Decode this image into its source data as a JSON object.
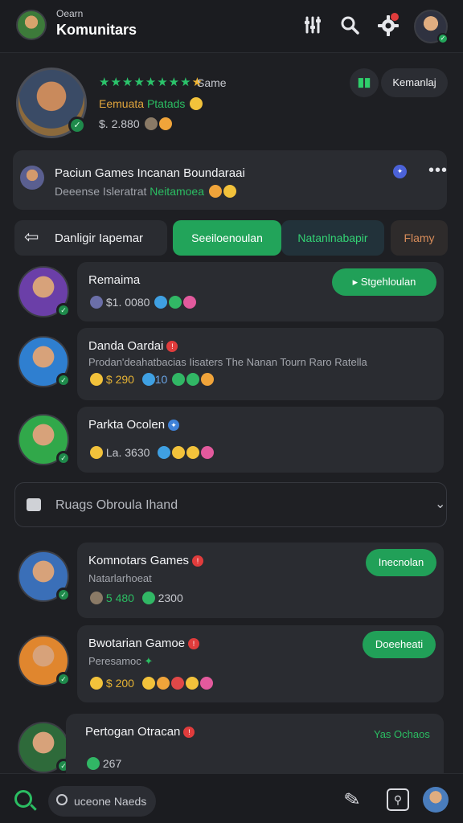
{
  "header": {
    "subtitle": "Oearn",
    "title": "Komunitars"
  },
  "profile": {
    "stars_label": "Same",
    "sub_orange": "Eemuata",
    "sub_green": "Ptatads",
    "value": "$. 2.880"
  },
  "profile_actions": {
    "signal_label": "▮▮",
    "pill_label": "Kemanlaj"
  },
  "post": {
    "title": "Paciun Games Incanan Boundaraai",
    "sub_gray": "Deeense Isleratrat",
    "sub_green": "Neitamoea"
  },
  "tabs": {
    "back_label": "Danligir Iapemar",
    "active": "Seeiloenoulan",
    "second": "Natanlnabapir",
    "third": "Flamy"
  },
  "rows": [
    {
      "name": "Remaima",
      "meta": "$1. 0080",
      "button": "Stgehloulan"
    },
    {
      "name": "Danda Oardai",
      "desc": "Prodan'deahatbacias Iisaters The Nanan Tourn Raro Ratella",
      "meta": "$ 290",
      "meta2": "10"
    },
    {
      "name": "Parkta Ocolen",
      "meta": "La. 3630"
    }
  ],
  "dropdown": {
    "label": "Ruags Obroula Ihand"
  },
  "game_rows": [
    {
      "name": "Komnotars Games",
      "desc": "Natarlarhoeat",
      "meta_green": "5 480",
      "meta2": "2300",
      "button": "Inecnolan"
    },
    {
      "name": "Bwotarian Gamoe",
      "desc": "Peresamoc",
      "meta": "$ 200",
      "button": "Doeeheati"
    },
    {
      "name": "Pertogan Otracan",
      "meta": "267",
      "link": "Yas Ochaos"
    }
  ],
  "bottom": {
    "search_placeholder": "uceone Naeds"
  }
}
